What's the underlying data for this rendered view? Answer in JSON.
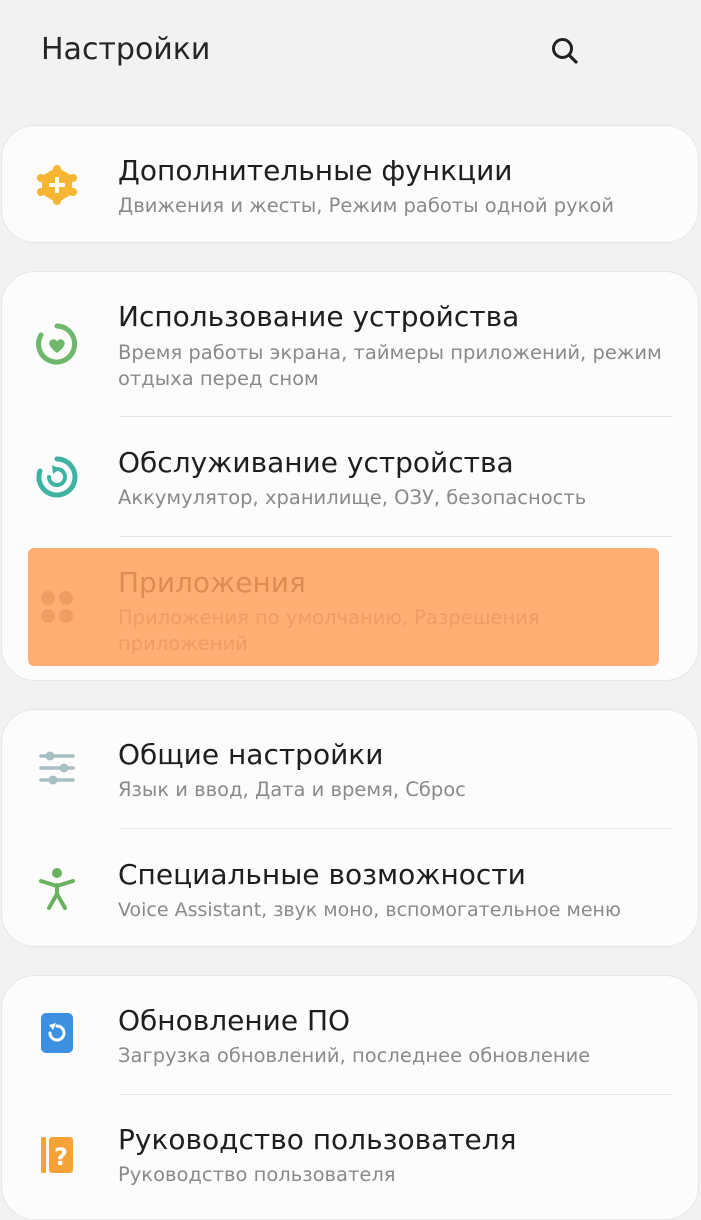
{
  "header": {
    "title": "Настройки",
    "search_icon": "search-icon"
  },
  "items": {
    "advanced": {
      "title": "Дополнительные функции",
      "subtitle": "Движения и жесты, Режим работы одной рукой",
      "icon": "gear-plus-icon",
      "color": "#f7b632"
    },
    "wellbeing": {
      "title": "Использование устройства",
      "subtitle": "Время работы экрана, таймеры приложений, режим отдыха перед сном",
      "icon": "heart-ring-icon",
      "color": "#6db86b"
    },
    "device_care": {
      "title": "Обслуживание устройства",
      "subtitle": "Аккумулятор, хранилище, ОЗУ, безопасность",
      "icon": "refresh-ring-icon",
      "color": "#3fb3a3"
    },
    "apps": {
      "title": "Приложения",
      "subtitle": "Приложения по умолчанию, Разрешения приложений",
      "icon": "apps-grid-icon",
      "color": "#8e8e8e"
    },
    "general": {
      "title": "Общие настройки",
      "subtitle": "Язык и ввод, Дата и время, Сброс",
      "icon": "sliders-icon",
      "color": "#a8bfc4"
    },
    "accessibility": {
      "title": "Специальные возможности",
      "subtitle": "Voice Assistant, звук моно, вспомогательное меню",
      "icon": "accessibility-person-icon",
      "color": "#6ab35e"
    },
    "software_update": {
      "title": "Обновление ПО",
      "subtitle": "Загрузка обновлений, последнее обновление",
      "icon": "update-icon",
      "color": "#3d8fe0"
    },
    "user_manual": {
      "title": "Руководство пользователя",
      "subtitle": "Руководство пользователя",
      "icon": "manual-question-icon",
      "color": "#f5a236"
    }
  },
  "highlight_color": "#ffa05c"
}
